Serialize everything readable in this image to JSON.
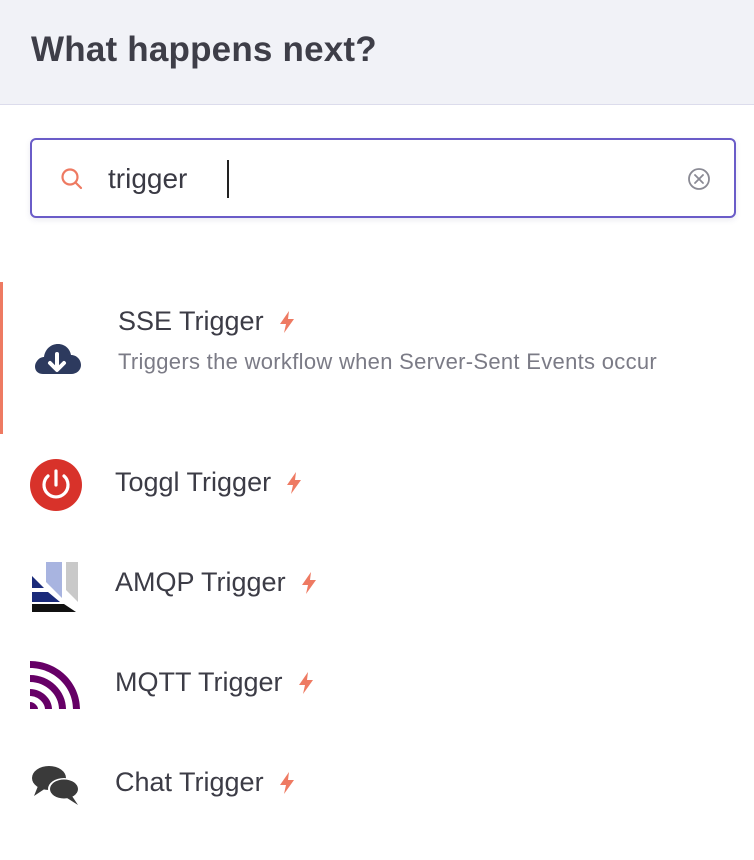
{
  "header": {
    "title": "What happens next?"
  },
  "search": {
    "value": "trigger"
  },
  "items": [
    {
      "title": "SSE Trigger",
      "description": "Triggers the workflow when Server-Sent Events occur",
      "icon": "cloud-download-icon",
      "is_trigger": true,
      "selected": true
    },
    {
      "title": "Toggl Trigger",
      "icon": "toggl-power-icon",
      "is_trigger": true
    },
    {
      "title": "AMQP Trigger",
      "icon": "amqp-icon",
      "is_trigger": true
    },
    {
      "title": "MQTT Trigger",
      "icon": "mqtt-icon",
      "is_trigger": true
    },
    {
      "title": "Chat Trigger",
      "icon": "chat-bubbles-icon",
      "is_trigger": true
    }
  ],
  "colors": {
    "accent": "#ee7a62",
    "search_border": "#6a5cc8",
    "header_bg": "#f1f2f7",
    "toggl_red": "#d8322a",
    "mqtt_purple": "#660066",
    "amqp_blue": "#1a2a7a"
  }
}
